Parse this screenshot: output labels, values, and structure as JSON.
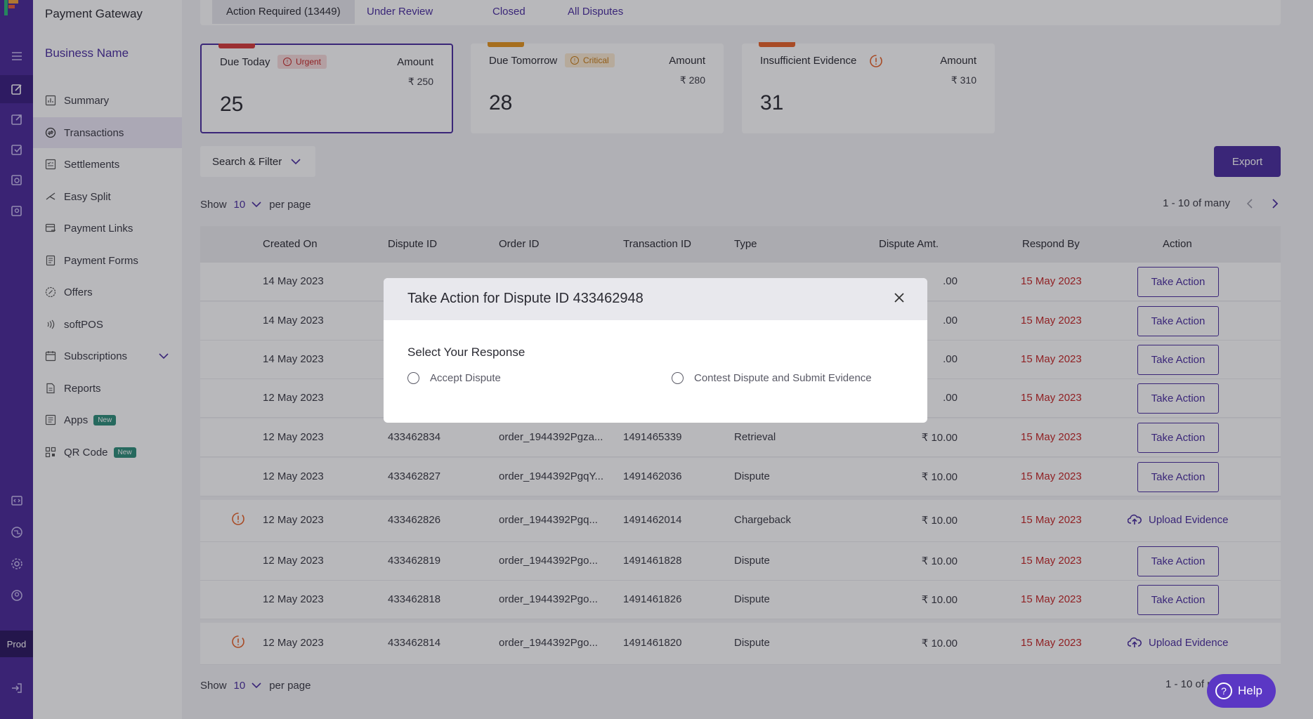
{
  "app": {
    "title": "Payment Gateway",
    "business": "Business Name",
    "env": "Prod"
  },
  "sidebar": {
    "items": [
      {
        "label": "Summary",
        "icon": "summary-icon"
      },
      {
        "label": "Transactions",
        "icon": "transactions-icon",
        "active": true
      },
      {
        "label": "Settlements",
        "icon": "settlements-icon"
      },
      {
        "label": "Easy Split",
        "icon": "split-icon"
      },
      {
        "label": "Payment Links",
        "icon": "link-icon"
      },
      {
        "label": "Payment Forms",
        "icon": "form-icon"
      },
      {
        "label": "Offers",
        "icon": "offers-icon"
      },
      {
        "label": "softPOS",
        "icon": "softpos-icon"
      },
      {
        "label": "Subscriptions",
        "icon": "subscriptions-icon"
      },
      {
        "label": "Reports",
        "icon": "reports-icon"
      },
      {
        "label": "Apps",
        "icon": "apps-icon",
        "badge": "New"
      },
      {
        "label": "QR Code",
        "icon": "qr-icon",
        "badge": "New"
      }
    ]
  },
  "tabs": [
    "Action Required (13449)",
    "Under Review",
    "Closed",
    "All Disputes"
  ],
  "cards": [
    {
      "title": "Due Today",
      "pill": "Urgent",
      "amount_label": "Amount",
      "amount": "₹ 250",
      "count": "25"
    },
    {
      "title": "Due Tomorrow",
      "pill": "Critical",
      "amount_label": "Amount",
      "amount": "₹ 280",
      "count": "28"
    },
    {
      "title": "Insufficient Evidence",
      "amount_label": "Amount",
      "amount": "₹ 310",
      "count": "31"
    }
  ],
  "toolbar": {
    "filter": "Search & Filter",
    "export": "Export"
  },
  "pagination": {
    "show": "Show",
    "page_size": "10",
    "per_page": "per page",
    "range": "1 - 10 of many"
  },
  "table": {
    "headers": [
      "Created On",
      "Dispute ID",
      "Order ID",
      "Transaction ID",
      "Type",
      "Dispute Amt.",
      "Respond By",
      "Action"
    ],
    "rows": [
      {
        "created": "14 May 2023",
        "dispute_id": "",
        "order_id": "",
        "txn_id": "",
        "type": "",
        "amount": ".00",
        "respond_by": "15 May 2023",
        "action": "Take Action"
      },
      {
        "created": "14 May 2023",
        "dispute_id": "",
        "order_id": "",
        "txn_id": "",
        "type": "",
        "amount": ".00",
        "respond_by": "15 May 2023",
        "action": "Take Action"
      },
      {
        "created": "14 May 2023",
        "dispute_id": "",
        "order_id": "",
        "txn_id": "",
        "type": "",
        "amount": ".00",
        "respond_by": "15 May 2023",
        "action": "Take Action"
      },
      {
        "created": "12 May 2023",
        "dispute_id": "",
        "order_id": "",
        "txn_id": "",
        "type": "",
        "amount": ".00",
        "respond_by": "15 May 2023",
        "action": "Take Action"
      },
      {
        "created": "12 May 2023",
        "dispute_id": "433462834",
        "order_id": "order_1944392Pgza...",
        "txn_id": "1491465339",
        "type": "Retrieval",
        "amount": "₹ 10.00",
        "respond_by": "15 May 2023",
        "action": "Take Action"
      },
      {
        "created": "12 May 2023",
        "dispute_id": "433462827",
        "order_id": "order_1944392PgqY...",
        "txn_id": "1491462036",
        "type": "Dispute",
        "amount": "₹ 10.00",
        "respond_by": "15 May 2023",
        "action": "Take Action"
      },
      {
        "created": "12 May 2023",
        "dispute_id": "433462826",
        "order_id": "order_1944392Pgq...",
        "txn_id": "1491462014",
        "type": "Chargeback",
        "amount": "₹ 10.00",
        "respond_by": "15 May 2023",
        "action": "Upload Evidence",
        "flag": true
      },
      {
        "created": "12 May 2023",
        "dispute_id": "433462819",
        "order_id": "order_1944392Pgo...",
        "txn_id": "1491461828",
        "type": "Dispute",
        "amount": "₹ 10.00",
        "respond_by": "15 May 2023",
        "action": "Take Action"
      },
      {
        "created": "12 May 2023",
        "dispute_id": "433462818",
        "order_id": "order_1944392Pgo...",
        "txn_id": "1491461826",
        "type": "Dispute",
        "amount": "₹ 10.00",
        "respond_by": "15 May 2023",
        "action": "Take Action"
      },
      {
        "created": "12 May 2023",
        "dispute_id": "433462814",
        "order_id": "order_1944392Pgo...",
        "txn_id": "1491461820",
        "type": "Dispute",
        "amount": "₹ 10.00",
        "respond_by": "15 May 2023",
        "action": "Upload Evidence",
        "flag": true
      }
    ]
  },
  "bottom_pagination": {
    "show": "Show",
    "page_size": "10",
    "per_page": "per page",
    "range": "1 - 10 of n"
  },
  "modal": {
    "title": "Take Action for Dispute ID 433462948",
    "subtitle": "Select Your Response",
    "options": [
      "Accept Dispute",
      "Contest Dispute and Submit Evidence"
    ]
  },
  "help": {
    "label": "Help"
  },
  "colors": {
    "brand": "#4b2fa0",
    "rail": "#4b2a9a",
    "urgent": "#c62828",
    "critical": "#c77b14"
  }
}
